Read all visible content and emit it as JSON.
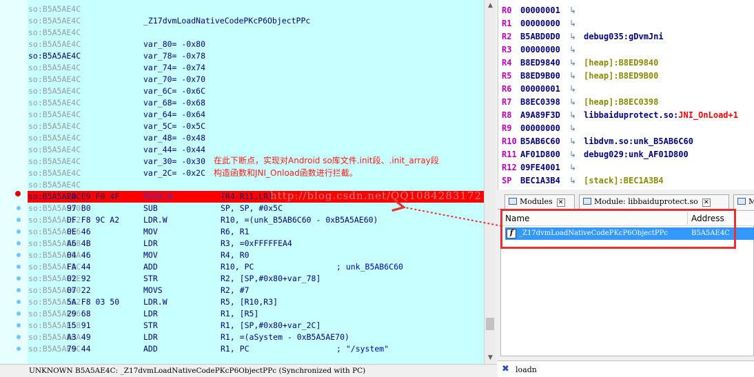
{
  "disasm": {
    "lines": [
      {
        "addr": "so:B5A5AE4C",
        "text": "",
        "kind": "plain"
      },
      {
        "addr": "so:B5A5AE4C",
        "text": "_Z17dvmLoadNativeCodePKcP6ObjectPPc",
        "kind": "sym"
      },
      {
        "addr": "so:B5A5AE4C",
        "text": "",
        "kind": "plain"
      },
      {
        "addr": "so:B5A5AE4C",
        "text": "var_80= -0x80",
        "kind": "sym"
      },
      {
        "addr": "so:B5A5AE4C",
        "text": "var_78= -0x78",
        "kind": "sym",
        "blue": true
      },
      {
        "addr": "so:B5A5AE4C",
        "text": "var_74= -0x74",
        "kind": "sym"
      },
      {
        "addr": "so:B5A5AE4C",
        "text": "var_70= -0x70",
        "kind": "sym"
      },
      {
        "addr": "so:B5A5AE4C",
        "text": "var_6C= -0x6C",
        "kind": "sym"
      },
      {
        "addr": "so:B5A5AE4C",
        "text": "var_68= -0x68",
        "kind": "sym"
      },
      {
        "addr": "so:B5A5AE4C",
        "text": "var_64= -0x64",
        "kind": "sym"
      },
      {
        "addr": "so:B5A5AE4C",
        "text": "var_5C= -0x5C",
        "kind": "sym"
      },
      {
        "addr": "so:B5A5AE4C",
        "text": "var_48= -0x48",
        "kind": "sym"
      },
      {
        "addr": "so:B5A5AE4C",
        "text": "var_44= -0x44",
        "kind": "sym"
      },
      {
        "addr": "so:B5A5AE4C",
        "text": "var_30= -0x30",
        "kind": "sym"
      },
      {
        "addr": "so:B5A5AE4C",
        "text": "var_2C= -0x2C",
        "kind": "sym"
      },
      {
        "addr": "so:B5A5AE4C",
        "text": "",
        "kind": "plain"
      },
      {
        "addr": "so:B5A5AE4C",
        "bytes": "2D E9 F0 4F",
        "mn": "PUSH.W",
        "op": "{R4-R11,LR}",
        "kind": "insn",
        "bp": true
      },
      {
        "addr": "so:B5A5AE50",
        "bytes": "97 B0",
        "mn": "SUB",
        "op": "SP, SP, #0x5C",
        "kind": "insn"
      },
      {
        "addr": "so:B5A5AE52",
        "bytes": "DF F8 9C A2",
        "mn": "LDR.W",
        "op": "R10, =(unk_B5AB6C60 - 0xB5A5AE60)",
        "kind": "insn"
      },
      {
        "addr": "so:B5A5AE56",
        "bytes": "0E 46",
        "mn": "MOV",
        "op": "R6, R1",
        "kind": "insn"
      },
      {
        "addr": "so:B5A5AE58",
        "bytes": "A6 4B",
        "mn": "LDR",
        "op": "R3, =0xFFFFFEA4",
        "kind": "insn"
      },
      {
        "addr": "so:B5A5AE5A",
        "bytes": "04 46",
        "mn": "MOV",
        "op": "R4, R0",
        "kind": "insn"
      },
      {
        "addr": "so:B5A5AE5C",
        "bytes": "FA 44",
        "mn": "ADD",
        "op": "R10, PC",
        "cm": "; unk_B5AB6C60",
        "kind": "insn"
      },
      {
        "addr": "so:B5A5AE5E",
        "bytes": "02 92",
        "mn": "STR",
        "op": "R2, [SP,#0x80+var_78]",
        "kind": "insn"
      },
      {
        "addr": "so:B5A5AE60",
        "bytes": "07 22",
        "mn": "MOVS",
        "op": "R2, #7",
        "kind": "insn"
      },
      {
        "addr": "so:B5A5AE62",
        "bytes": "5A F8 03 50",
        "mn": "LDR.W",
        "op": "R5, [R10,R3]",
        "kind": "insn"
      },
      {
        "addr": "so:B5A5AE66",
        "bytes": "29 68",
        "mn": "LDR",
        "op": "R1, [R5]",
        "kind": "insn"
      },
      {
        "addr": "so:B5A5AE68",
        "bytes": "15 91",
        "mn": "STR",
        "op": "R1, [SP,#0x80+var_2C]",
        "kind": "insn"
      },
      {
        "addr": "so:B5A5AE6A",
        "bytes": "A3 49",
        "mn": "LDR",
        "op": "R1, =(aSystem - 0xB5A5AE70)",
        "kind": "insn"
      },
      {
        "addr": "so:B5A5AE6C",
        "bytes": "79 44",
        "mn": "ADD",
        "op": "R1, PC",
        "cm": "; \"/system\"",
        "kind": "insn"
      }
    ],
    "annotation_line1": "在此下断点，实现对Android so库文件.init段、.init_array段",
    "annotation_line2": "构造函数和JNI_Onload函数进行拦截。",
    "watermark": "http://blog.csdn.net/QQ1084283172",
    "status": "UNKNOWN B5A5AE4C: _Z17dvmLoadNativeCodePKcP6ObjectPPc (Synchronized with PC)"
  },
  "registers": [
    {
      "name": "R0",
      "value": "00000001",
      "ref": ""
    },
    {
      "name": "R1",
      "value": "00000000",
      "ref": ""
    },
    {
      "name": "R2",
      "value": "B5ABD0D0",
      "ref_seg": "debug035:",
      "ref_name": "gDvmJni"
    },
    {
      "name": "R3",
      "value": "00000000",
      "ref": ""
    },
    {
      "name": "R4",
      "value": "B8ED9840",
      "ref_seg": "[heap]:",
      "ref_name": "B8ED9840",
      "seg_color": true
    },
    {
      "name": "R5",
      "value": "B8ED9B00",
      "ref_seg": "[heap]:",
      "ref_name": "B8ED9B00",
      "seg_color": true
    },
    {
      "name": "R6",
      "value": "00000001",
      "ref": ""
    },
    {
      "name": "R7",
      "value": "B8EC0398",
      "ref_seg": "[heap]:",
      "ref_name": "B8EC0398",
      "seg_color": true
    },
    {
      "name": "R8",
      "value": "A9A89F3D",
      "ref_seg": "libbaiduprotect.so:",
      "ref_fn": "JNI_OnLoad+1"
    },
    {
      "name": "R9",
      "value": "00000000",
      "ref": ""
    },
    {
      "name": "R10",
      "value": "B5AB6C60",
      "ref_seg": "libdvm.so:",
      "ref_name": "unk_B5AB6C60"
    },
    {
      "name": "R11",
      "value": "AF01D800",
      "ref_seg": "debug029:",
      "ref_name": "unk_AF01D800"
    },
    {
      "name": "R12",
      "value": "09FE4001",
      "ref": ""
    },
    {
      "name": "SP",
      "value": "BEC1A3B4",
      "ref_seg": "[stack]:",
      "ref_name": "BEC1A3B4",
      "seg_color": true
    }
  ],
  "tabs": [
    {
      "label": "Modules"
    },
    {
      "label": "Module: libbaiduprotect.so"
    },
    {
      "label": "Mo"
    }
  ],
  "functions": {
    "col_name": "Name",
    "col_address": "Address",
    "row": {
      "icon": "f",
      "name": "_Z17dvmLoadNativeCodePKcP6ObjectPPc",
      "address": "B5A5AE4C"
    }
  },
  "search": {
    "value": "loadn"
  },
  "icons": {
    "arrow": "arrow-right-icon",
    "close": "close-icon",
    "module": "module-icon",
    "function": "function-icon"
  },
  "colors": {
    "disasm_bg": "#c8ffff",
    "breakpoint": "#ff0000",
    "annotation": "#ff1a1a",
    "selection": "#3399ff",
    "highlight_box": "#e83030"
  }
}
